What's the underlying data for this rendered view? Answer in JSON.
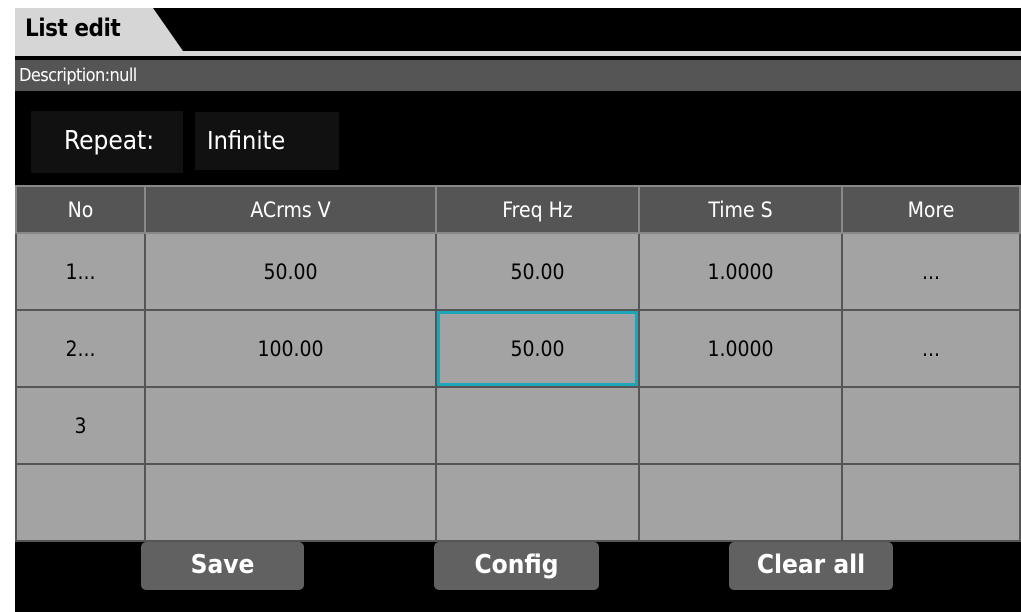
{
  "title": "List edit",
  "description": "Description:null",
  "repeat": {
    "label": "Repeat:",
    "value": "Infinite"
  },
  "table": {
    "headers": [
      "No",
      "ACrms V",
      "Freq Hz",
      "Time S",
      "More"
    ],
    "rows": [
      [
        "1...",
        "50.00",
        "50.00",
        "1.0000",
        "..."
      ],
      [
        "2...",
        "100.00",
        "50.00",
        "1.0000",
        "..."
      ],
      [
        "3",
        "",
        "",
        "",
        ""
      ],
      [
        "",
        "",
        "",
        "",
        ""
      ]
    ]
  },
  "buttons": {
    "save": "Save",
    "config": "Config",
    "clear_all": "Clear all"
  },
  "colors": {
    "selected_cell_border": "#1ea5b9",
    "cell_bg": "#a3a3a3",
    "header_bg": "#555555"
  }
}
